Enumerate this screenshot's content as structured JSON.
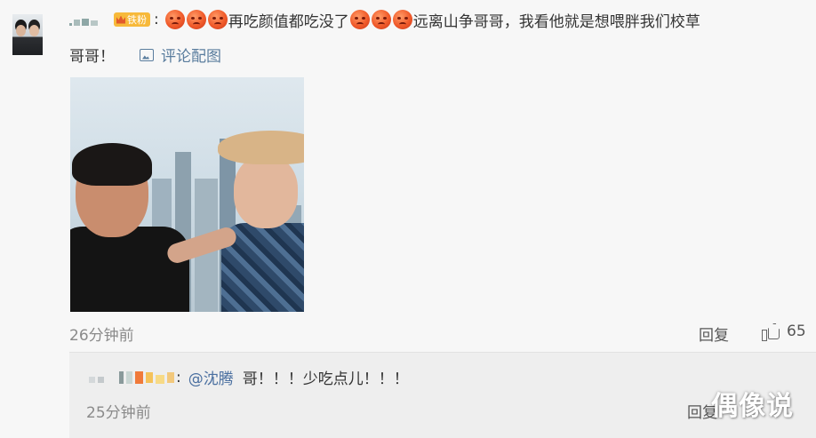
{
  "comment": {
    "badge_label": "铁粉",
    "text_part1": "再吃颜值都吃没了",
    "text_part2": "远离山争哥哥，我看他就是想喂胖我们校草",
    "text_line2": "哥哥！",
    "image_link_label": "评论配图",
    "time": "26分钟前",
    "reply_label": "回复",
    "like_count": "65",
    "emoji_icon": "angry-face-emoji"
  },
  "sub_reply": {
    "mention": "@沈腾",
    "text": "哥！！！少吃点儿！！！",
    "time": "25分钟前",
    "reply_label": "回复"
  },
  "watermark": "偶像说",
  "colors": {
    "background": "#f7f7f7",
    "sub_background": "#eeeeee",
    "link": "#5a7d9e",
    "mention": "#4a6fa0",
    "badge": "#f7b93a",
    "meta": "#8a8a8a"
  }
}
